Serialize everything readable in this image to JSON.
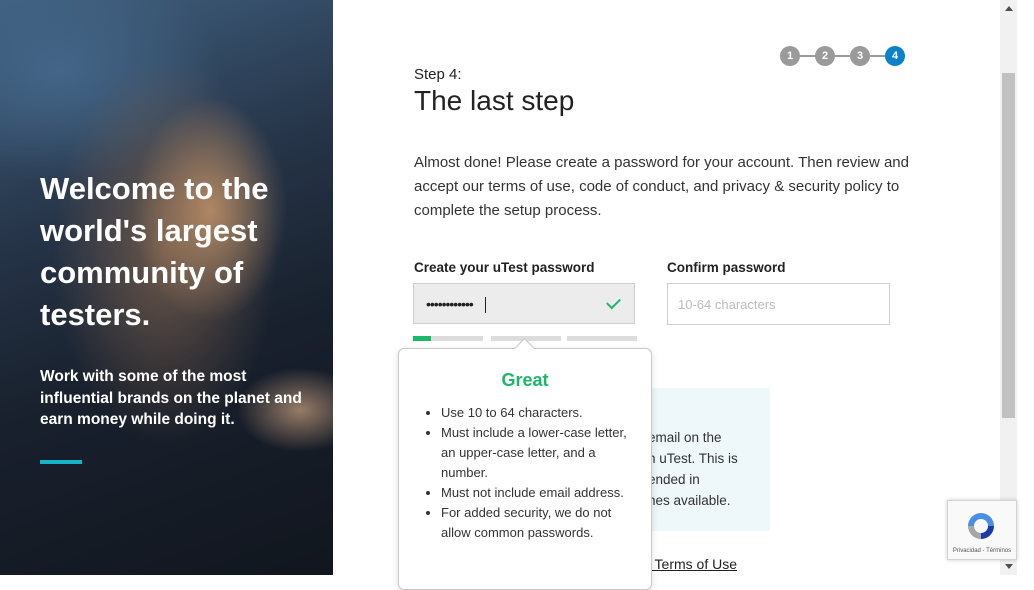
{
  "hero": {
    "title": "Welcome to the world's largest community of testers.",
    "subtitle": "Work with some of the most influential brands on the planet and earn money while doing it."
  },
  "steps": [
    "1",
    "2",
    "3",
    "4"
  ],
  "active_step": "4",
  "form": {
    "step_label": "Step 4:",
    "title": "The last step",
    "intro": "Almost done! Please create a password for your account. Then review and accept our terms of use, code of conduct, and privacy & security policy to complete the setup process.",
    "password_label": "Create your uTest password",
    "password_value": "••••••••••••",
    "confirm_label": "Confirm password",
    "confirm_placeholder": "10-64 characters",
    "strength_level": 0.25
  },
  "tooltip": {
    "heading": "Great",
    "rules": [
      "Use 10 to 64 characters.",
      "Must include a lower-case letter, an upper-case letter, and a number.",
      "Must not include email address.",
      "For added security, we do not allow common passwords."
    ]
  },
  "info_box": {
    "lines": [
      "email on the",
      "n uTest. This is",
      "ended in",
      "nes available."
    ]
  },
  "terms_link": "st Terms of Use",
  "recaptcha": {
    "footer": "Privacidad - Términos"
  },
  "colors": {
    "accent": "#18b3c9",
    "success": "#1cb86a",
    "active_step": "#0c82c9"
  }
}
